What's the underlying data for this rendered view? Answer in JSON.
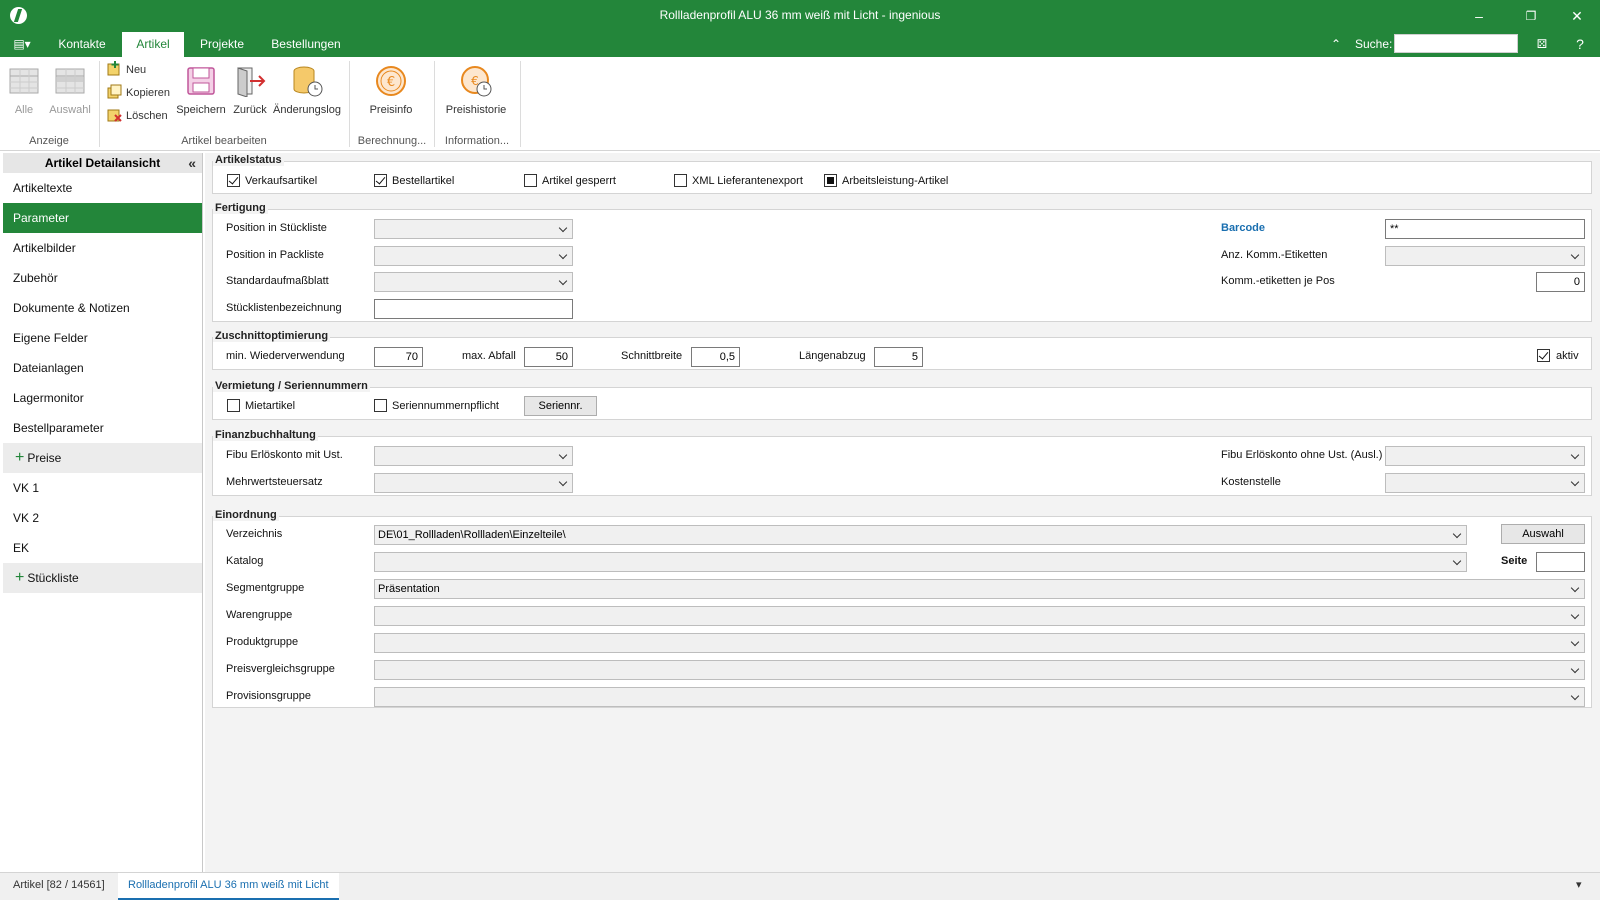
{
  "window": {
    "title": "Rollladenprofil ALU 36 mm weiß mit Licht - ingenious"
  },
  "menu": {
    "tabs": [
      "Kontakte",
      "Artikel",
      "Projekte",
      "Bestellungen"
    ],
    "search_label": "Suche:",
    "search_value": "",
    "help_label": "?"
  },
  "ribbon": {
    "all_label": "Alle",
    "selection_label": "Auswahl",
    "new_label": "Neu",
    "copy_label": "Kopieren",
    "delete_label": "Löschen",
    "save_label": "Speichern",
    "back_label": "Zurück",
    "changelog_label": "Änderungslog",
    "priceinfo_label": "Preisinfo",
    "pricehistory_label": "Preishistorie",
    "groups": [
      "Anzeige",
      "Artikel bearbeiten",
      "Berechnung...",
      "Information..."
    ],
    "accent_color": "#e8881e"
  },
  "sidebar": {
    "title": "Artikel Detailansicht",
    "items": [
      "Artikeltexte",
      "Parameter",
      "Artikelbilder",
      "Zubehör",
      "Dokumente & Notizen",
      "Eigene Felder",
      "Dateianlagen",
      "Lagermonitor",
      "Bestellparameter",
      "Preise",
      "VK 1",
      "VK 2",
      "EK",
      "Stückliste"
    ]
  },
  "status": {
    "legend": "Artikelstatus",
    "sales": "Verkaufsartikel",
    "order": "Bestellartikel",
    "locked": "Artikel gesperrt",
    "xml": "XML Lieferantenexport",
    "labor": "Arbeitsleistung-Artikel"
  },
  "fertigung": {
    "legend": "Fertigung",
    "pos_stueckliste": "Position in Stückliste",
    "pos_packliste": "Position in Packliste",
    "standardaufmass": "Standardaufmaßblatt",
    "stuecklistenbez": "Stücklistenbezeichnung",
    "barcode_label": "Barcode",
    "barcode_value": "**",
    "komm_etiketten": "Anz. Komm.-Etiketten",
    "komm_je_pos": "Komm.-etiketten je Pos",
    "komm_je_pos_value": "0"
  },
  "zuschnitt": {
    "legend": "Zuschnittoptimierung",
    "min_label": "min. Wiederverwendung",
    "min_value": "70",
    "max_label": "max. Abfall",
    "max_value": "50",
    "schnitt_label": "Schnittbreite",
    "schnitt_value": "0,5",
    "laengen_label": "Längenabzug",
    "laengen_value": "5",
    "aktiv_label": "aktiv"
  },
  "vermietung": {
    "legend": "Vermietung / Seriennummern",
    "miet": "Mietartikel",
    "serien": "Seriennummernpflicht",
    "serien_btn": "Seriennr."
  },
  "fibu": {
    "legend": "Finanzbuchhaltung",
    "erloes_mit": "Fibu Erlöskonto mit Ust.",
    "mwst": "Mehrwertsteuersatz",
    "erloes_ohne": "Fibu Erlöskonto ohne Ust. (Ausl.)",
    "kostenstelle": "Kostenstelle"
  },
  "einordnung": {
    "legend": "Einordnung",
    "verzeichnis_label": "Verzeichnis",
    "verzeichnis_value": "DE\\01_Rollladen\\Rollladen\\Einzelteile\\",
    "auswahl_btn": "Auswahl",
    "katalog_label": "Katalog",
    "seite_label": "Seite",
    "segment_label": "Segmentgruppe",
    "segment_value": "Präsentation",
    "waren_label": "Warengruppe",
    "produkt_label": "Produktgruppe",
    "preisvergl_label": "Preisvergleichsgruppe",
    "provision_label": "Provisionsgruppe"
  },
  "statusbar": {
    "tab1": "Artikel [82 / 14561]",
    "tab2": "Rollladenprofil ALU 36 mm weiß mit Licht"
  }
}
